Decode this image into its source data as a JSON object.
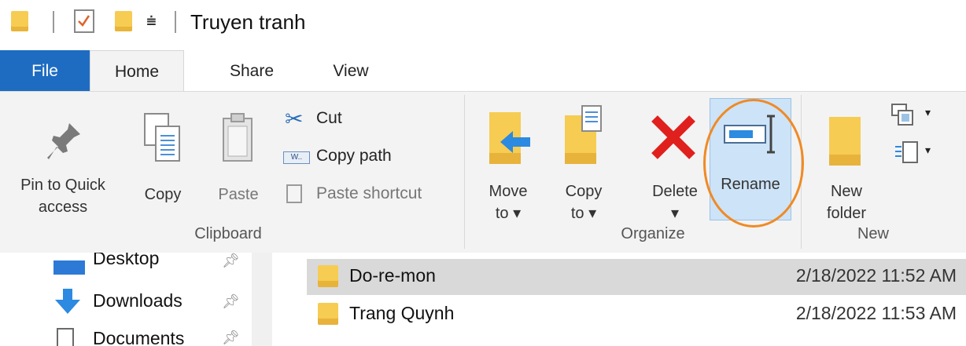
{
  "window": {
    "title": "Truyen tranh"
  },
  "tabs": {
    "file": "File",
    "home": "Home",
    "share": "Share",
    "view": "View"
  },
  "ribbon": {
    "clipboard": {
      "title": "Clipboard",
      "pin_line1": "Pin to Quick",
      "pin_line2": "access",
      "copy": "Copy",
      "paste": "Paste",
      "cut": "Cut",
      "copy_path": "Copy path",
      "paste_shortcut": "Paste shortcut"
    },
    "organize": {
      "title": "Organize",
      "move_line1": "Move",
      "move_line2": "to ▾",
      "copy_line1": "Copy",
      "copy_line2": "to ▾",
      "delete_line1": "Delete",
      "delete_line2": "▾",
      "rename": "Rename"
    },
    "new": {
      "title": "New",
      "folder_line1": "New",
      "folder_line2": "folder"
    }
  },
  "nav": {
    "items": [
      {
        "label": "Desktop"
      },
      {
        "label": "Downloads"
      },
      {
        "label": "Documents"
      }
    ]
  },
  "files": [
    {
      "name": "Do-re-mon",
      "date": "2/18/2022 11:52 AM",
      "selected": true
    },
    {
      "name": "Trang Quynh",
      "date": "2/18/2022 11:53 AM",
      "selected": false
    }
  ],
  "colors": {
    "file_tab": "#1e6cc2",
    "folder": "#f6cc52",
    "delete": "#e0201d",
    "rename_highlight": "#cde3f7",
    "annotation": "#f08a24"
  }
}
